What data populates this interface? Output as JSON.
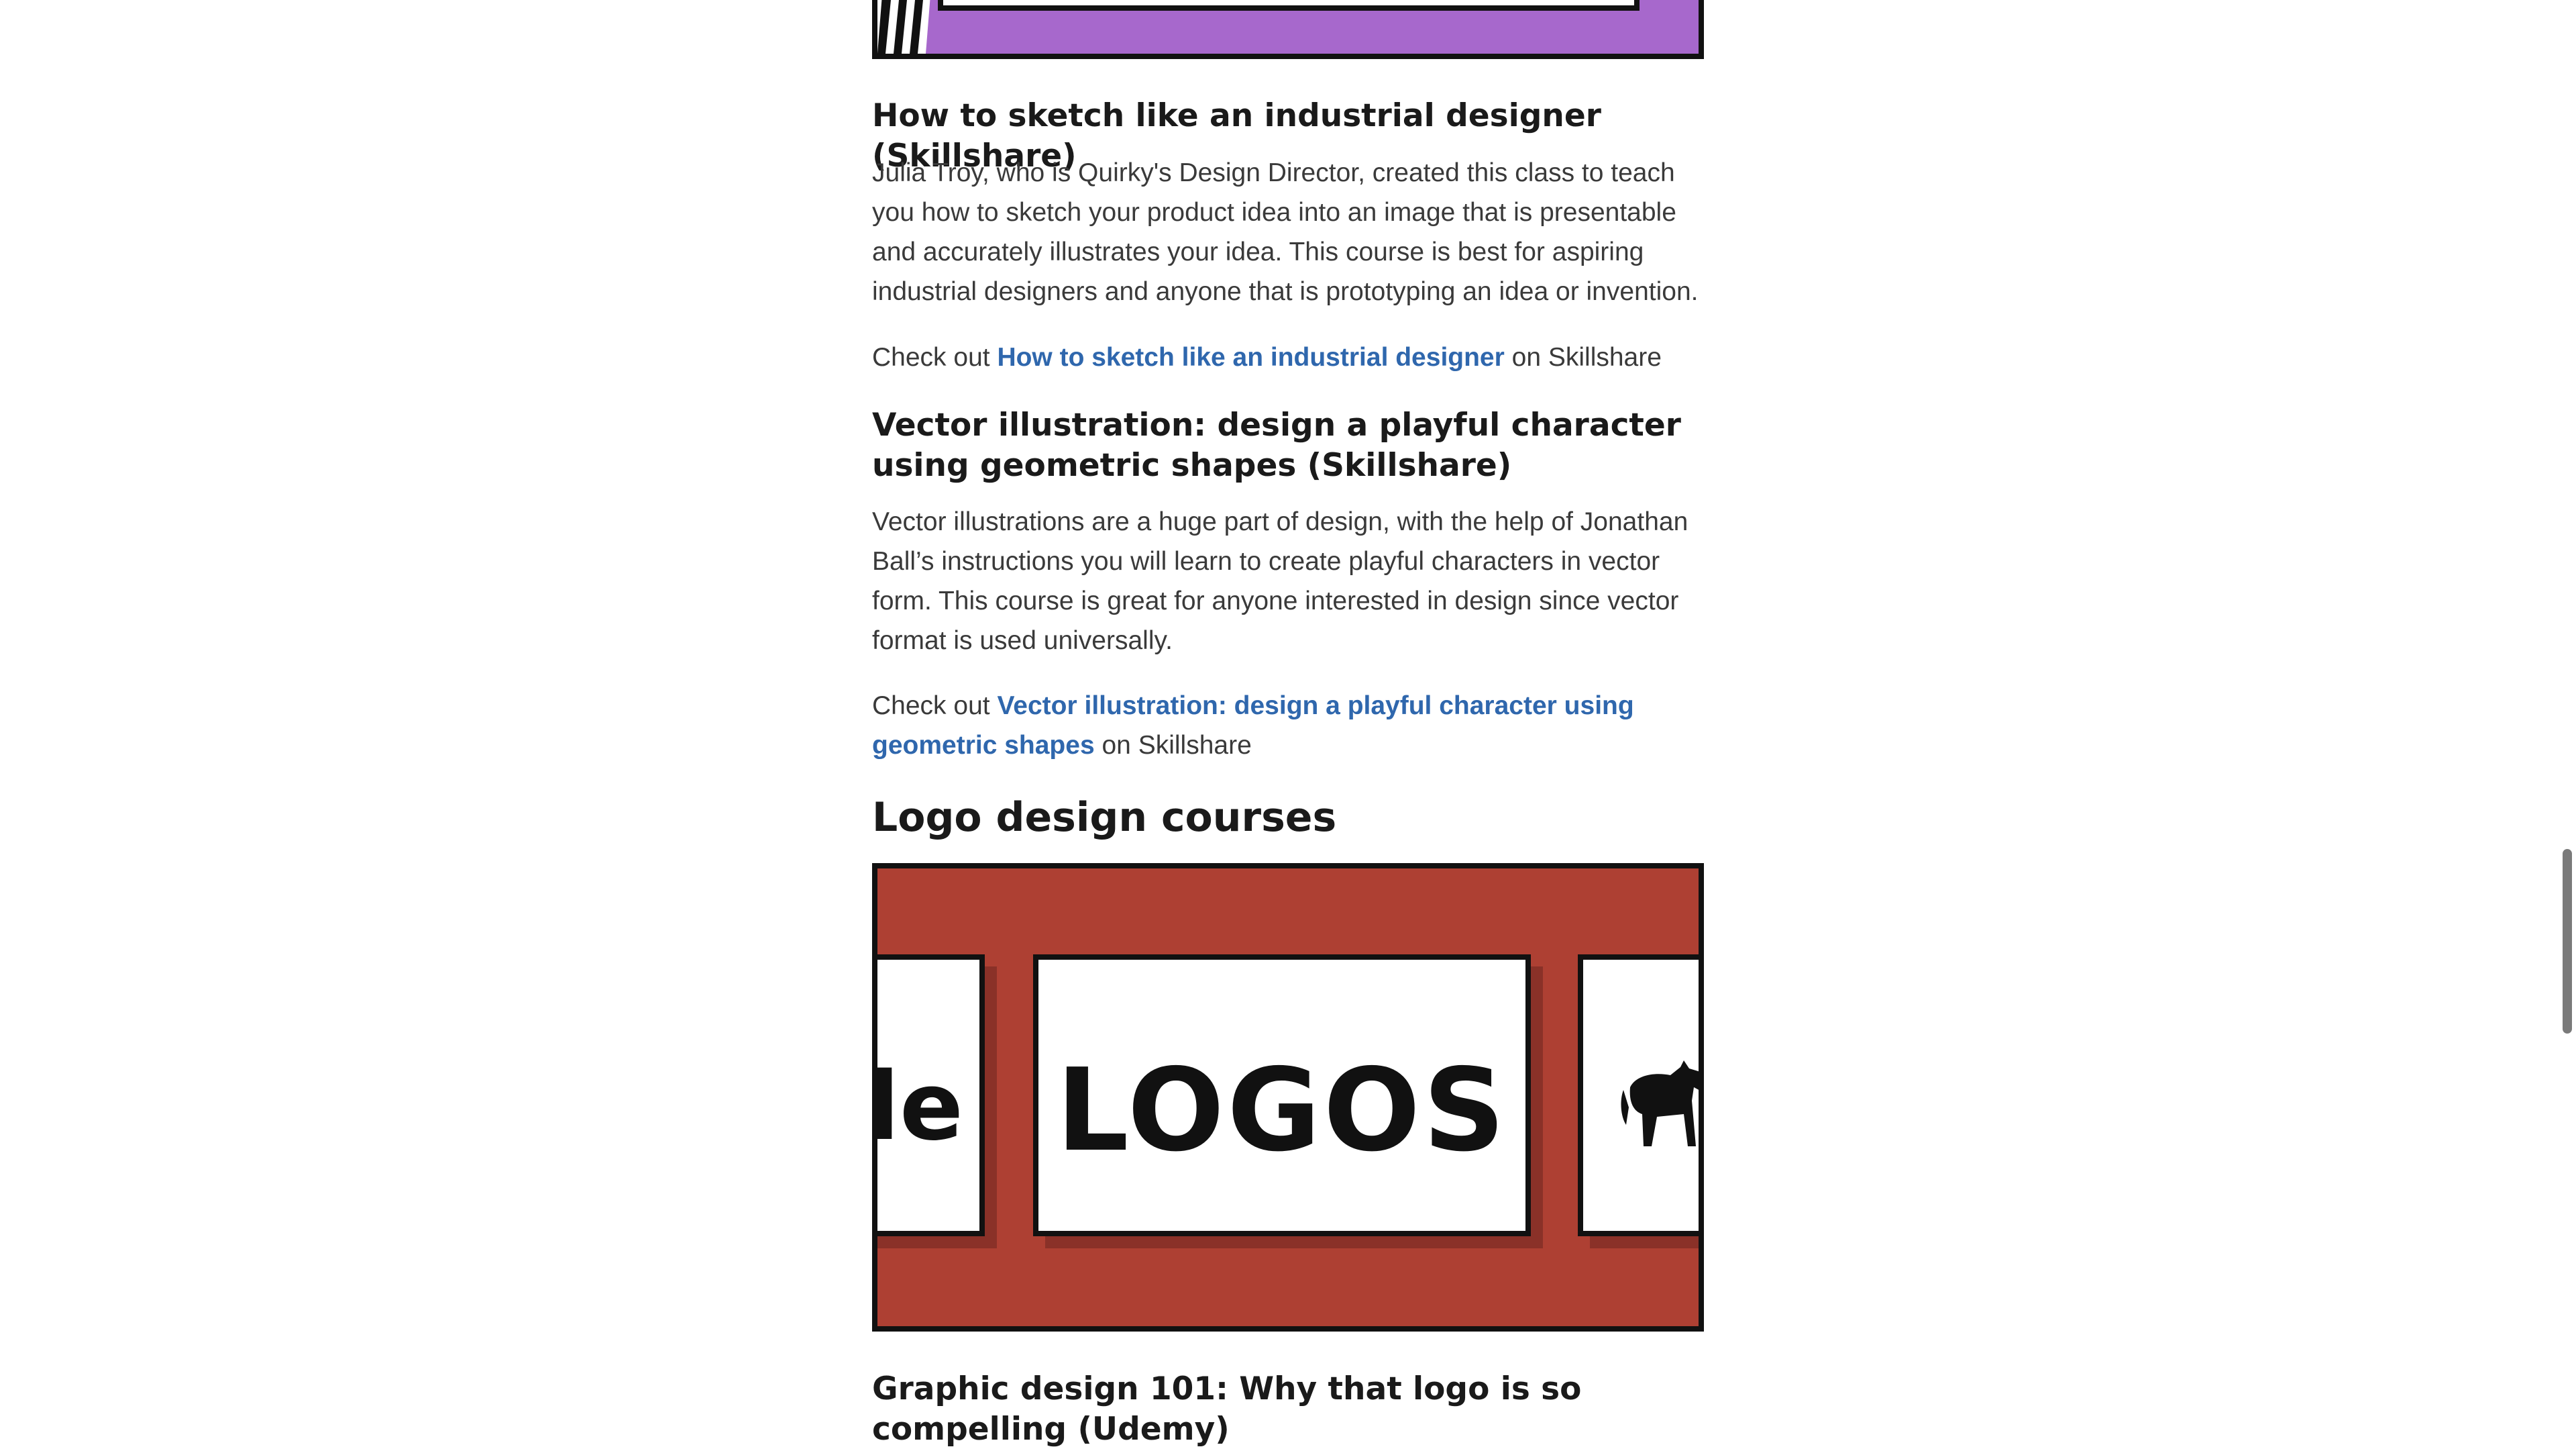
{
  "sections": {
    "sketch": {
      "title": "How to sketch like an industrial designer (Skillshare)",
      "description": "Julia Troy, who is Quirky's Design Director, created this class to teach you how to sketch your product idea into an image that is presentable and accurately illustrates your idea. This course is best for aspiring industrial designers and anyone that is prototyping an idea or invention.",
      "check_prefix": "Check out ",
      "link_text": "How to sketch like an industrial designer",
      "check_suffix": " on Skillshare"
    },
    "vector": {
      "title": "Vector illustration: design a playful character using geometric shapes (Skillshare)",
      "description": "Vector illustrations are a huge part of design, with the help of Jonathan Ball’s instructions you will learn to create playful characters in vector form. This course is great for anyone interested in design since vector format is used universally.",
      "check_prefix": "Check out ",
      "link_text": "Vector illustration: design a playful character using geometric shapes",
      "check_suffix": " on Skillshare"
    },
    "logo_heading": "Logo design courses",
    "logo_banner": {
      "center_word": "LOGOS",
      "left_partial_word": "le"
    },
    "graphic_design": {
      "title": "Graphic design 101: Why that logo is so compelling (Udemy)"
    }
  },
  "colors": {
    "link": "#2f67ad",
    "purple_banner": "#a768cc",
    "red_banner": "#ae4033"
  },
  "icons": {
    "horse": "horse-silhouette-icon"
  }
}
